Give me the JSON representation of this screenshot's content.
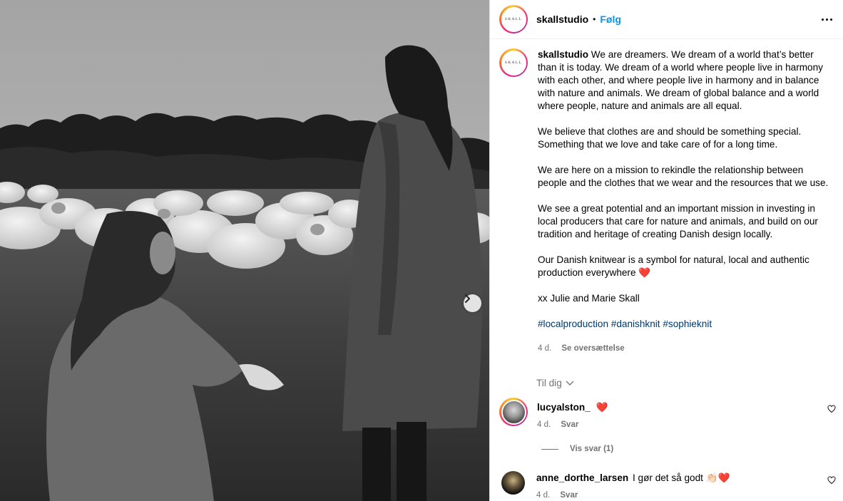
{
  "post": {
    "username": "skallstudio",
    "avatar_text": "SKALL",
    "follow_label": "Følg",
    "separator": "•",
    "more_icon": "more-horizontal-icon",
    "next_icon": "chevron-right-icon"
  },
  "caption": {
    "username": "skallstudio",
    "paragraphs": [
      "We are dreamers. We dream of a world that’s better than it is today. We dream of a world where people live in harmony with each other, and where people live in harmony and in balance with nature and animals. We dream of global balance and a world where people, nature and animals are all equal.",
      "We believe that clothes are and should be something special. Something that we love and take care of for a long time.",
      "We are here on a mission to rekindle the relationship between people and the clothes that we wear and the resources that we use.",
      "We see a great potential and an important mission in investing in local producers that care for nature and animals, and build on our tradition and heritage of creating Danish design locally.",
      "Our Danish knitwear is a symbol for natural, local and authentic production everywhere",
      "xx Julie and Marie Skall"
    ],
    "emoji": "❤️",
    "hashtags": [
      "#localproduction",
      "#danishknit",
      "#sophieknit"
    ],
    "time": "4 d.",
    "translate_label": "Se oversættelse"
  },
  "comments_sort": {
    "label": "Til dig",
    "icon": "chevron-down-icon"
  },
  "comments": [
    {
      "username": "lucyalston_",
      "text": "❤️",
      "time": "4 d.",
      "reply_label": "Svar",
      "has_story_ring": true
    },
    {
      "username": "anne_dorthe_larsen",
      "text": "I gør det så godt 👏🏻❤️",
      "time": "4 d.",
      "reply_label": "Svar",
      "has_story_ring": false
    }
  ],
  "view_replies": {
    "label": "Vis svar (1)"
  },
  "colors": {
    "link_blue": "#0095f6",
    "hashtag": "#00376b",
    "muted": "#737373",
    "heart": "#e0245e"
  }
}
